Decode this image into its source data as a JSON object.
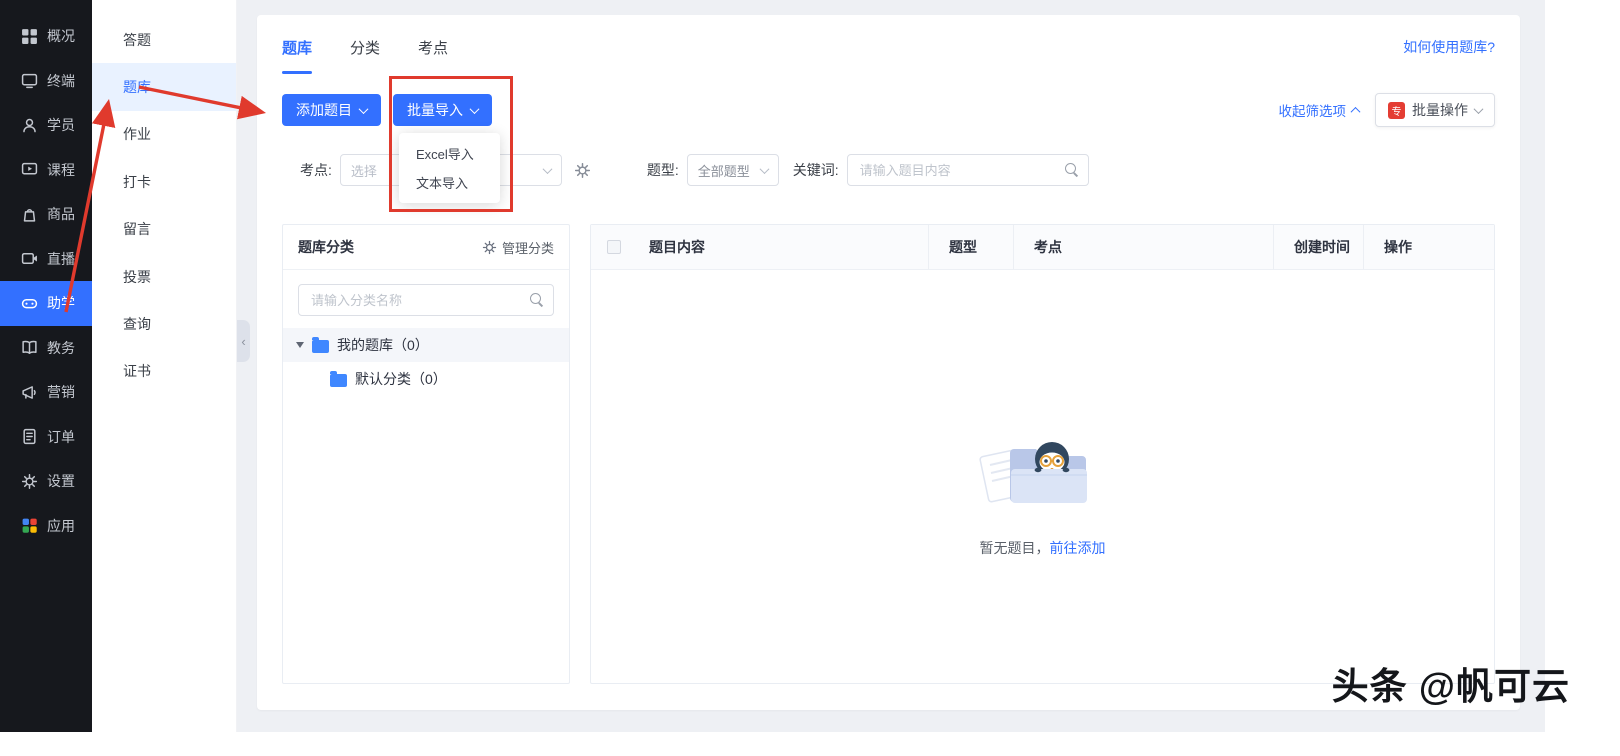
{
  "colors": {
    "accent": "#3370ff",
    "annotation_red": "#e03a2d",
    "sidebar_bg": "#16181d",
    "active_item_bg": "#e9f2ff"
  },
  "icons": {
    "collapse": "‹"
  },
  "primary_sidebar": {
    "active_index": 6,
    "items": [
      {
        "label": "概况",
        "icon": "grid"
      },
      {
        "label": "终端",
        "icon": "terminal"
      },
      {
        "label": "学员",
        "icon": "users"
      },
      {
        "label": "课程",
        "icon": "course"
      },
      {
        "label": "商品",
        "icon": "goods"
      },
      {
        "label": "直播",
        "icon": "live"
      },
      {
        "label": "助学",
        "icon": "study"
      },
      {
        "label": "教务",
        "icon": "edu"
      },
      {
        "label": "营销",
        "icon": "marketing"
      },
      {
        "label": "订单",
        "icon": "order"
      },
      {
        "label": "设置",
        "icon": "settings"
      },
      {
        "label": "应用",
        "icon": "apps"
      }
    ]
  },
  "secondary_sidebar": {
    "active_index": 1,
    "items": [
      "答题",
      "题库",
      "作业",
      "打卡",
      "留言",
      "投票",
      "查询",
      "证书"
    ]
  },
  "header": {
    "tabs": [
      "题库",
      "分类",
      "考点"
    ],
    "active_tab": 0,
    "help_link": "如何使用题库?"
  },
  "toolbar": {
    "add_button": "添加题目",
    "import_button": "批量导入",
    "import_menu": [
      "Excel导入",
      "文本导入"
    ],
    "collapse_filters": "收起筛选项",
    "batch_button": "批量操作",
    "batch_badge": "专"
  },
  "filters": {
    "kaodian_label": "考点:",
    "kaodian_value": "选择",
    "type_label": "题型:",
    "type_value": "全部题型",
    "keyword_label": "关键词:",
    "keyword_placeholder": "请输入题目内容"
  },
  "category_panel": {
    "title": "题库分类",
    "manage_label": "管理分类",
    "search_placeholder": "请输入分类名称",
    "tree": [
      {
        "label": "我的题库（0）",
        "level": 0
      },
      {
        "label": "默认分类（0）",
        "level": 1
      }
    ]
  },
  "table": {
    "columns": [
      "题目内容",
      "题型",
      "考点",
      "创建时间",
      "操作"
    ],
    "empty_text": "暂无题目，",
    "empty_link": "前往添加"
  },
  "watermark": "头条 @帆可云"
}
